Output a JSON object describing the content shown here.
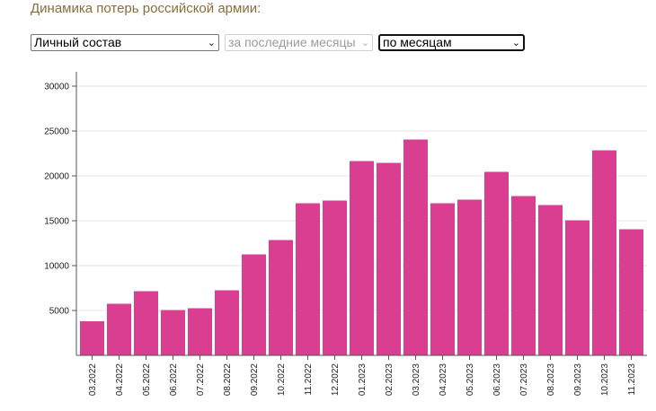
{
  "title": "Динамика потерь российской армии:",
  "controls": {
    "metric": "Личный состав",
    "period": "за последние месяцы",
    "grouping": "по месяцам"
  },
  "colors": {
    "bar": "#d93e91",
    "grid": "#e5e5e5",
    "axis": "#555555"
  },
  "chart_data": {
    "type": "bar",
    "categories": [
      "03.2022",
      "04.2022",
      "05.2022",
      "06.2022",
      "07.2022",
      "08.2022",
      "09.2022",
      "10.2022",
      "11.2022",
      "12.2022",
      "01.2023",
      "02.2023",
      "03.2023",
      "04.2023",
      "05.2023",
      "06.2023",
      "07.2023",
      "08.2023",
      "09.2023",
      "10.2023",
      "11.2023"
    ],
    "values": [
      3800,
      5750,
      7150,
      5050,
      5250,
      7250,
      11250,
      12850,
      16950,
      17250,
      21650,
      21450,
      24050,
      16950,
      17350,
      20450,
      17750,
      16750,
      15050,
      22850,
      14050
    ],
    "yticks": [
      5000,
      10000,
      15000,
      20000,
      25000,
      30000
    ],
    "ylim": [
      0,
      30000
    ],
    "grid": true
  }
}
